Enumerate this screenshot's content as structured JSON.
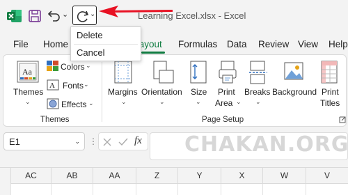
{
  "titlebar": {
    "title": "Learning Excel.xlsx - Excel",
    "icons": [
      "excel-logo-icon",
      "save-icon",
      "undo-icon",
      "redo-icon"
    ],
    "accent": "#e81123"
  },
  "redo_menu": {
    "items": [
      "Delete",
      "Cancel"
    ]
  },
  "tabs": [
    "File",
    "Home",
    "Page Layout",
    "Formulas",
    "Data",
    "Review",
    "View",
    "Help"
  ],
  "active_tab": "Page Layout",
  "ribbon": {
    "themes": {
      "themes_label": "Themes",
      "colors_label": "Colors",
      "fonts_label": "Fonts",
      "effects_label": "Effects",
      "group_label": "Themes"
    },
    "page_setup": {
      "margins": "Margins",
      "orientation": "Orientation",
      "size": "Size",
      "print_area_1": "Print",
      "print_area_2": "Area",
      "breaks": "Breaks",
      "background": "Background",
      "print_titles_1": "Print",
      "print_titles_2": "Titles",
      "group_label": "Page Setup"
    }
  },
  "formula_bar": {
    "name_box": "E1",
    "fx": "fx",
    "value": ""
  },
  "watermark": "CHAKAN.ORG",
  "columns": [
    "AC",
    "AB",
    "AA",
    "Z",
    "Y",
    "X",
    "W",
    "V"
  ],
  "colors": {
    "excel_green": "#107c41",
    "arrow_red": "#e81123"
  }
}
